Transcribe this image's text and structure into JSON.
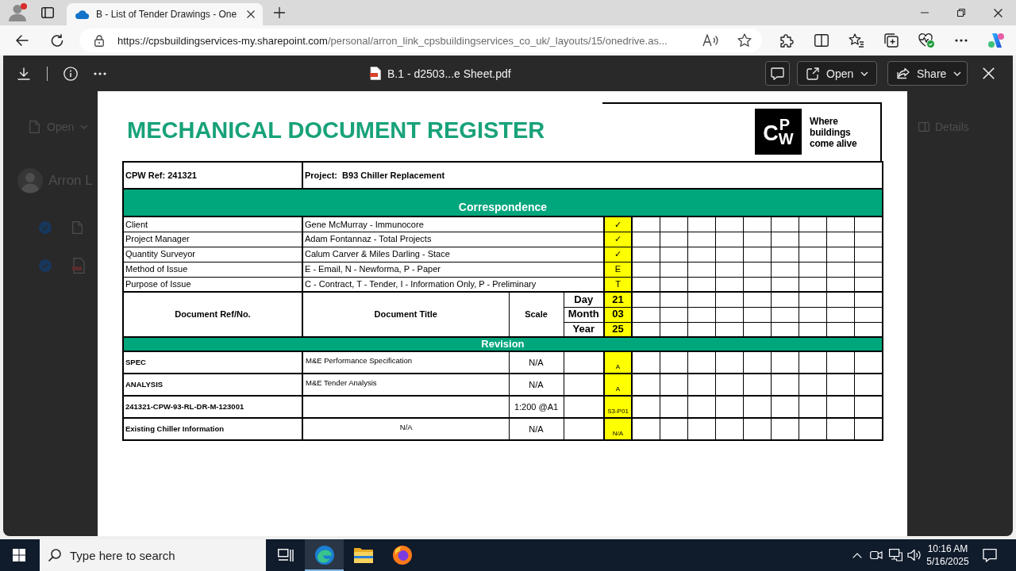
{
  "browser": {
    "tabs": [
      {
        "title": "B - List of Tender Drawings - One",
        "selected": true
      }
    ],
    "address": {
      "host": "https://cpsbuildingservices-my.sharepoint.com",
      "path": "/personal/arron_link_cpsbuildingservices_co_uk/_layouts/15/onedrive.as..."
    }
  },
  "onedrive_background": {
    "command": "Open",
    "owner": "Arron L",
    "files": [
      {
        "kind": "document",
        "selected": true
      },
      {
        "kind": "pdf",
        "selected": true
      }
    ],
    "pane_button": "Details"
  },
  "viewer": {
    "file_name": "B.1 - d2503...e Sheet.pdf",
    "buttons": [
      {
        "kind": "open",
        "label": "Open"
      },
      {
        "kind": "share",
        "label": "Share"
      }
    ]
  },
  "document": {
    "title": "MECHANICAL DOCUMENT REGISTER",
    "logo": {
      "mark": "CPW",
      "tagline": [
        "Where",
        "buildings",
        "come alive"
      ]
    },
    "reference": "CPW Ref: 241321",
    "project": "Project:  B93 Chiller Replacement",
    "correspondence": {
      "heading": "Correspondence",
      "rows": [
        {
          "label": "Client",
          "value": "Gene McMurray - Immunocore",
          "issue": "✓"
        },
        {
          "label": "Project Manager",
          "value": "Adam Fontannaz - Total Projects",
          "issue": "✓"
        },
        {
          "label": "Quantity Surveyor",
          "value": "Calum Carver & Miles Darling - Stace",
          "issue": "✓"
        },
        {
          "label": "Method of Issue",
          "value": "E - Email, N - Newforma, P - Paper",
          "issue": "E"
        },
        {
          "label": "Purpose of Issue",
          "value": "C - Contract, T - Tender, I - Information Only, P - Preliminary",
          "issue": "T"
        }
      ]
    },
    "columns": {
      "reference": "Document Ref/No.",
      "title": "Document Title",
      "scale": "Scale"
    },
    "issue_date": [
      {
        "label": "Day",
        "value": "21"
      },
      {
        "label": "Month",
        "value": "03"
      },
      {
        "label": "Year",
        "value": "25"
      }
    ],
    "revision": {
      "heading": "Revision",
      "rows": [
        {
          "reference": "SPEC",
          "title": "M&E Performance Specification",
          "scale": "N/A",
          "revision": "A"
        },
        {
          "reference": "ANALYSIS",
          "title": "M&E Tender Analysis",
          "scale": "N/A",
          "revision": "A"
        },
        {
          "reference": "241321-CPW-93-RL-DR-M-123001",
          "scale": "1:200 @A1",
          "revision": "S3-P01"
        },
        {
          "reference": "Existing Chiller Information",
          "title": "N/A",
          "scale": "N/A",
          "revision": "N/A"
        }
      ]
    }
  },
  "taskbar": {
    "search": {
      "placeholder": "Type here to search"
    },
    "apps": [
      {
        "kind": "edge",
        "selected": true
      },
      {
        "kind": "explorer",
        "selected": false
      },
      {
        "kind": "firefox",
        "selected": false
      }
    ],
    "clock": {
      "time": "10:16 AM",
      "date": "5/16/2025"
    }
  }
}
